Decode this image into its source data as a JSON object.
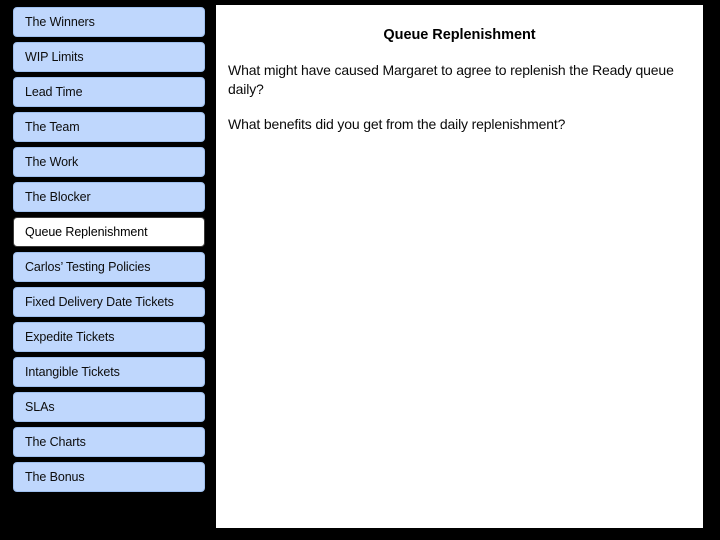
{
  "slide": {
    "background_color": "#000000",
    "panel_color": "#ffffff",
    "accent_color": "#bfd7fd",
    "selected_index": 6
  },
  "sidebar": {
    "items": [
      {
        "label": "The Winners",
        "selected": false
      },
      {
        "label": "WIP Limits",
        "selected": false
      },
      {
        "label": "Lead Time",
        "selected": false
      },
      {
        "label": "The Team",
        "selected": false
      },
      {
        "label": "The Work",
        "selected": false
      },
      {
        "label": "The Blocker",
        "selected": false
      },
      {
        "label": "Queue Replenishment",
        "selected": true
      },
      {
        "label": "Carlos’ Testing Policies",
        "selected": false
      },
      {
        "label": "Fixed Delivery Date Tickets",
        "selected": false
      },
      {
        "label": "Expedite Tickets",
        "selected": false
      },
      {
        "label": "Intangible Tickets",
        "selected": false
      },
      {
        "label": "SLAs",
        "selected": false
      },
      {
        "label": "The Charts",
        "selected": false
      },
      {
        "label": "The Bonus",
        "selected": false
      }
    ]
  },
  "content": {
    "title": "Queue Replenishment",
    "paragraphs": [
      "What might have caused Margaret to agree to replenish the Ready queue daily?",
      "What benefits did you get from the daily replenishment?"
    ]
  }
}
